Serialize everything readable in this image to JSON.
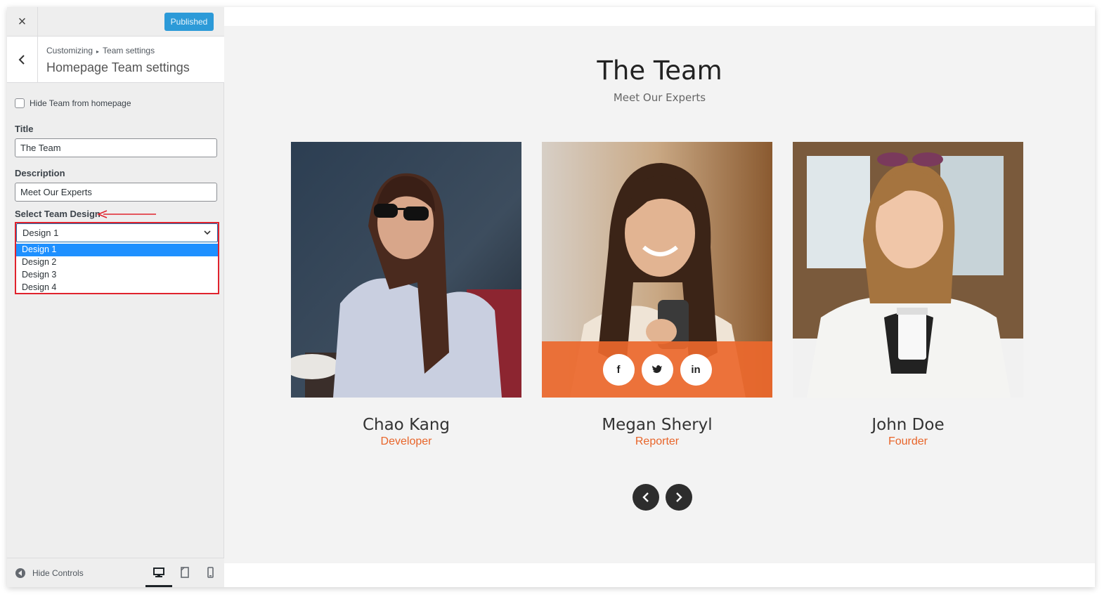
{
  "topbar": {
    "close_icon": "×",
    "publish_label": "Published",
    "publish_color": "#2c9ad8"
  },
  "section": {
    "breadcrumb_root": "Customizing",
    "breadcrumb_sep": "▸",
    "breadcrumb_leaf": "Team settings",
    "title": "Homepage Team settings"
  },
  "controls": {
    "hide_team_label": "Hide Team from homepage",
    "title_label": "Title",
    "title_value": "The Team",
    "description_label": "Description",
    "description_value": "Meet Our Experts",
    "design_label": "Select Team Design",
    "design_selected": "Design 1",
    "design_options": [
      "Design 1",
      "Design 2",
      "Design 3",
      "Design 4"
    ]
  },
  "footer": {
    "hide_controls_label": "Hide Controls",
    "devices": [
      "desktop-icon",
      "tablet-icon",
      "mobile-icon"
    ]
  },
  "preview": {
    "title": "The Team",
    "description": "Meet Our Experts",
    "accent_color": "#e8652a",
    "members": [
      {
        "name": "Chao Kang",
        "role": "Developer"
      },
      {
        "name": "Megan Sheryl",
        "role": "Reporter",
        "social": [
          "f",
          "twitter-icon",
          "in"
        ]
      },
      {
        "name": "John Doe",
        "role": "Fourder"
      }
    ]
  }
}
